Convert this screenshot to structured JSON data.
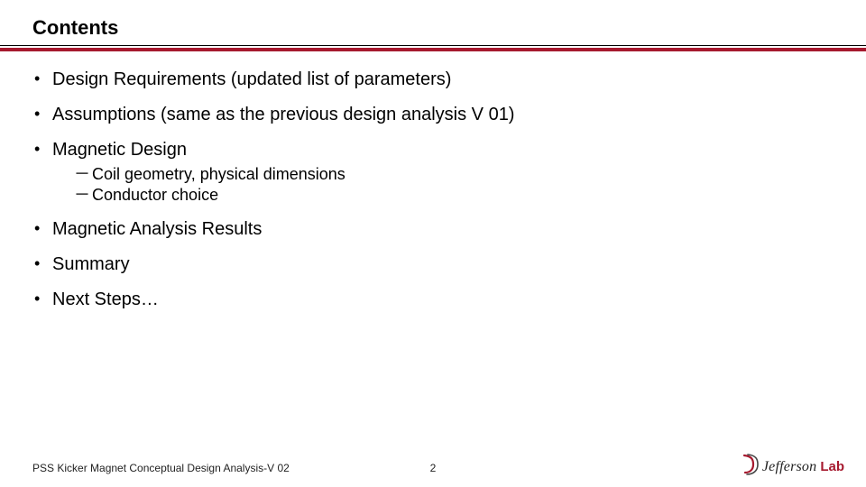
{
  "title": "Contents",
  "bullets": [
    {
      "text": "Design Requirements (updated list of parameters)"
    },
    {
      "text": "Assumptions (same as the previous design analysis V 01)"
    },
    {
      "text": "Magnetic Design",
      "sub": [
        "Coil geometry, physical dimensions",
        "Conductor choice"
      ]
    },
    {
      "text": "Magnetic Analysis Results"
    },
    {
      "text": "Summary"
    },
    {
      "text": "Next Steps…"
    }
  ],
  "footer": {
    "left": "PSS Kicker Magnet Conceptual Design Analysis-V 02",
    "page": "2"
  },
  "logo": {
    "brand_text": "Jefferson",
    "brand_accent": "Lab",
    "accent_color": "#a6192e"
  }
}
